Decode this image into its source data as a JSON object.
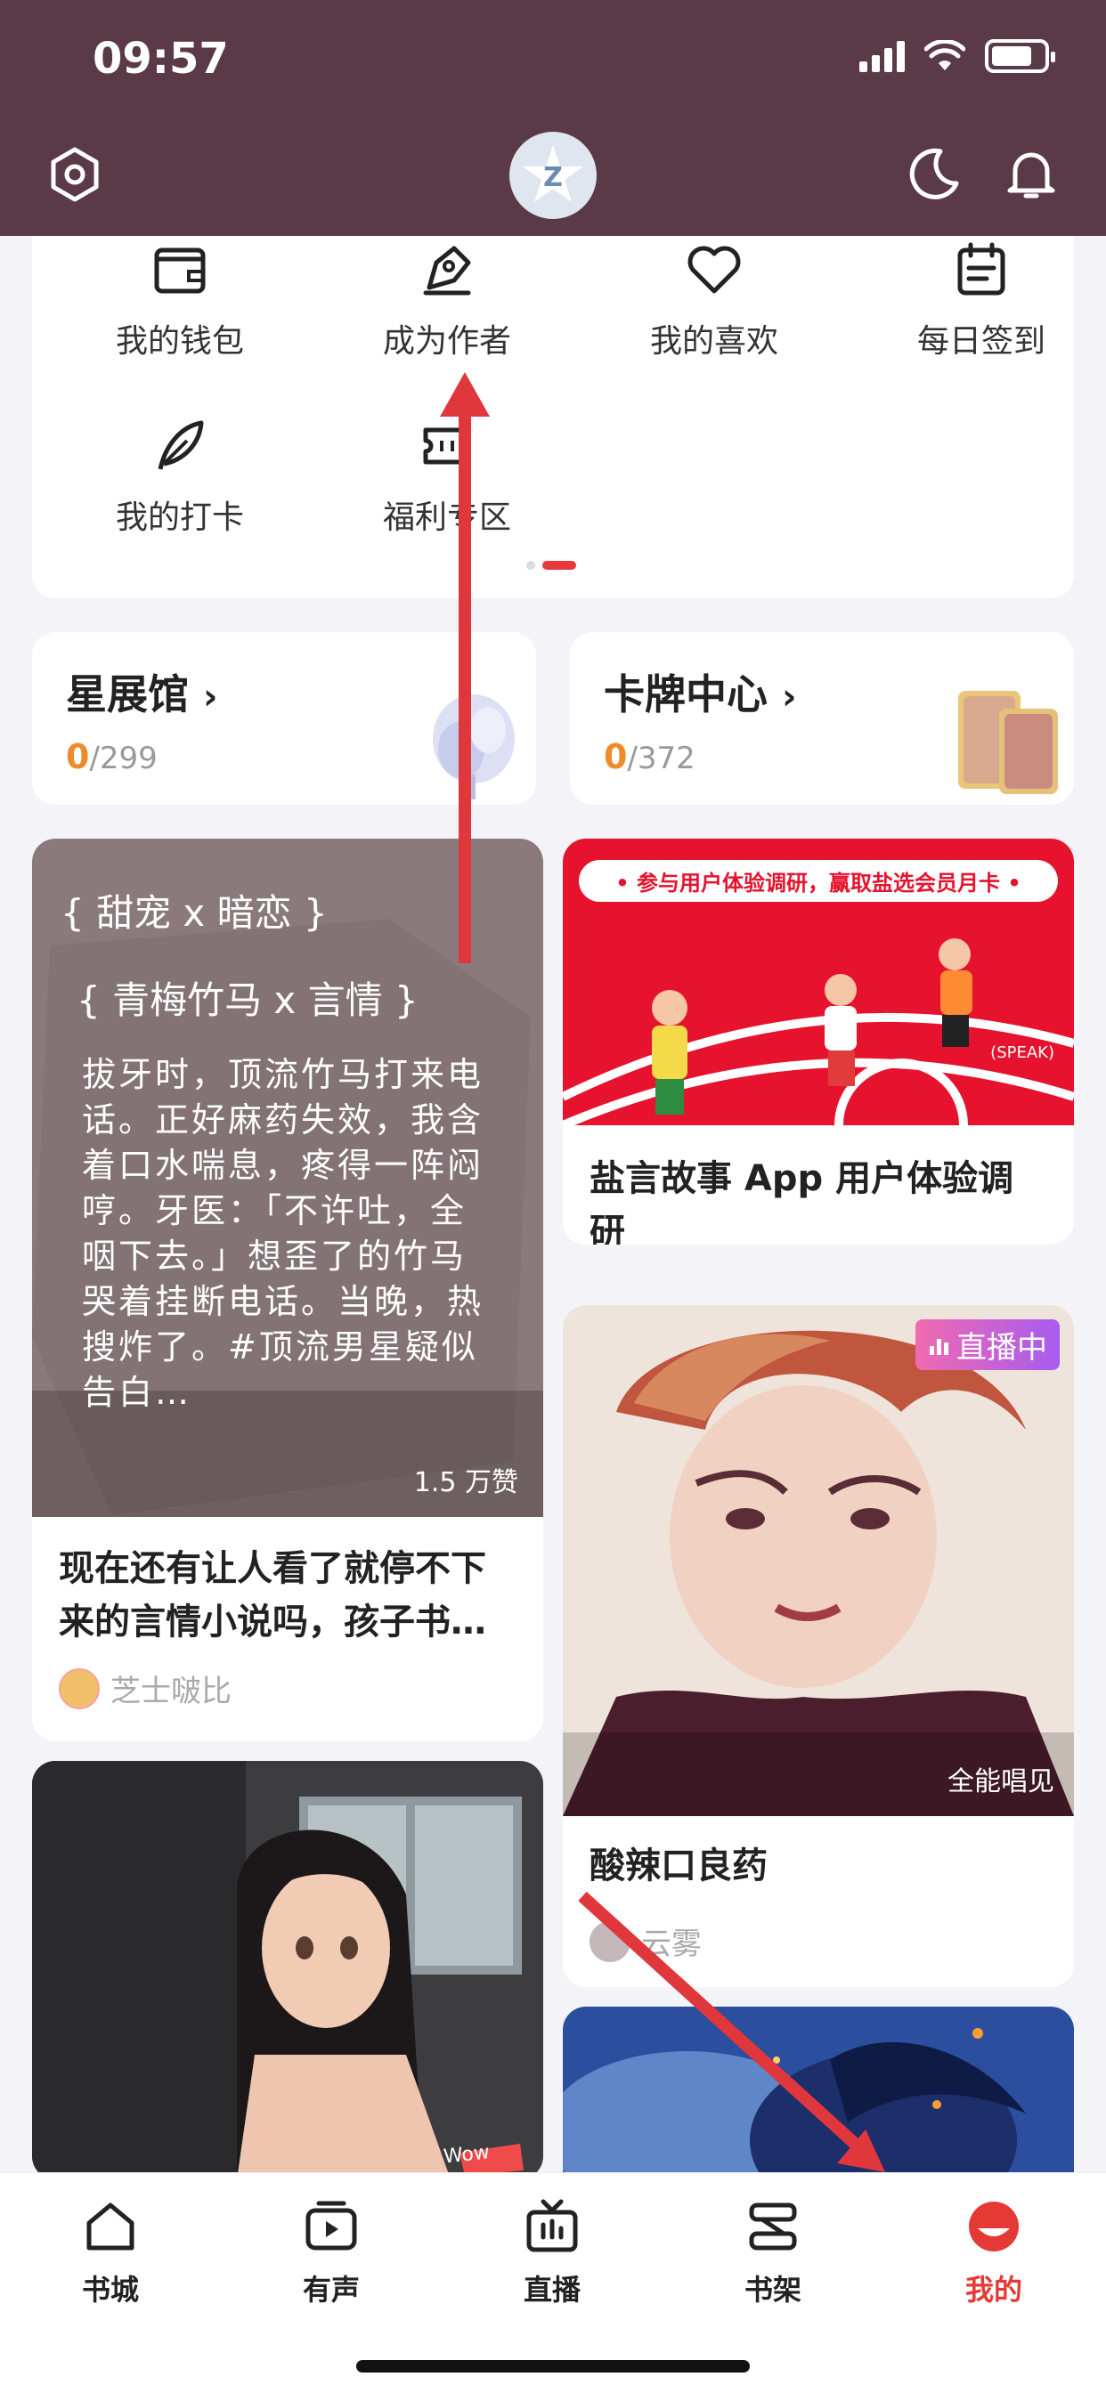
{
  "status_bar": {
    "time": "09:57"
  },
  "menu": {
    "items": [
      {
        "label": "我的钱包",
        "icon": "wallet-icon"
      },
      {
        "label": "成为作者",
        "icon": "pen-icon"
      },
      {
        "label": "我的喜欢",
        "icon": "heart-icon"
      },
      {
        "label": "每日签到",
        "icon": "calendar-icon"
      },
      {
        "label": "我的打卡",
        "icon": "feather-icon"
      },
      {
        "label": "福利专区",
        "icon": "ticket-icon"
      }
    ]
  },
  "stats": {
    "star_gallery": {
      "title": "星展馆",
      "arrow": "›",
      "count": "0",
      "total": "/299"
    },
    "card_center": {
      "title": "卡牌中心",
      "arrow": "›",
      "count": "0",
      "total": "/372"
    }
  },
  "feed": {
    "left_1": {
      "tag1": "{ 甜宠 x 暗恋 }",
      "tag2": "{ 青梅竹马 x 言情 }",
      "body": "拔牙时，顶流竹马打来电话。正好麻药失效，我含着口水喘息，疼得一阵闷哼。牙医：「不许吐，全咽下去。」想歪了的竹马哭着挂断电话。当晚，热搜炸了。#顶流男星疑似告白…",
      "likes": "1.5 万赞",
      "title": "现在还有让人看了就停不下来的言情小说吗，孩子书…",
      "author": "芝士啵比"
    },
    "left_2": {
      "badge": "Wow"
    },
    "right_1": {
      "banner": "• 参与用户体验调研，赢取盐选会员月卡 •",
      "speak": "(SPEAK)",
      "title": "盐言故事 App 用户体验调研"
    },
    "right_2": {
      "live_badge": "直播中",
      "caption": "全能唱见",
      "title": "酸辣口良药",
      "author": "云雾"
    }
  },
  "bottom_nav": {
    "items": [
      {
        "label": "书城"
      },
      {
        "label": "有声"
      },
      {
        "label": "直播"
      },
      {
        "label": "书架"
      },
      {
        "label": "我的"
      }
    ]
  },
  "colors": {
    "header": "#5b3a47",
    "accent": "#e53935",
    "orange": "#f08a2a"
  }
}
